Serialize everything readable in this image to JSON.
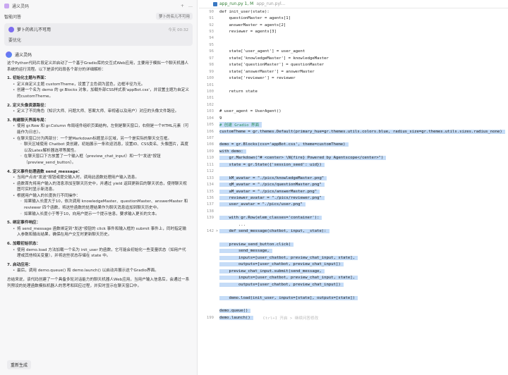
{
  "left": {
    "top_title": "通义灵码",
    "top_tool1": "+",
    "top_tool2": "…",
    "section_label": "智能问答",
    "section_tag": "萝卜的名儿不可用",
    "user_name": "萝卜的名儿不可用",
    "user_time": "今天 00:32",
    "user_msg": "要优化",
    "assistant_name": "通义灵码",
    "intro": "这个Python代码片段定义并启动了一个基于Gradio库的交互式Web应用，主要用于模拟一个聊天机器人系统的运行流程。以下是该代码段各个部分的详细解析：",
    "sections": [
      {
        "title": "1. 初始化主题与界面：",
        "items": [
          {
            "text": "定义自定义主题 customTheme，设置了主色调为蓝色，边框半径为无。"
          },
          {
            "text": "创建一个名为 demo 的 gr.Blocks 对象，加载外部CSS样式表'appBot.css'，并设置主题为自定义的customTheme。"
          }
        ]
      },
      {
        "title": "2. 定义头像资源路径：",
        "items": [
          {
            "text": "定义了不同角色（知识大师、问题大师、答案大师、审视者以及用户）对应的头像文件路径。"
          }
        ]
      },
      {
        "title": "3. 构建聊天界面布局：",
        "items": [
          {
            "text": "使用 gr.Row 和 gr.Column 布局组件组织页面结构，左侧是聊天窗口，右侧是一个HTML元素（可能作为日志）。"
          },
          {
            "text": "在聊天窗口分为两部分：一个是Markdown标题显示区域，另一个是实际的聊天交互框。"
          },
          {
            "text": "聊天区域使用 Chatbot 类创建，初始展示一条欢迎消息，设置ID、CSS类名、头像图片，高度以及Latex解析器选项等属性。",
            "child": true
          },
          {
            "text": "在聊天窗口下方放置了一个输入框（preview_chat_input）和一个\"发送\"按钮（preview_send_button）。",
            "child": true
          }
        ]
      },
      {
        "title": "4. 定义事件处理函数 send_message：",
        "items": [
          {
            "text": "当用户点击\"发送\"按钮或提交输入时，调用此函数处理用户输入消息。"
          },
          {
            "text": "函数首先将用户输入的消息添加至聊天历史中，并通过 yield 返回更新后的聊天状态，使得聊天视图可实时显示新消息。"
          },
          {
            "text": "根据用户输入的长度执行不同操作："
          },
          {
            "text": "如果输入长度大于10，依次调用 knowledgeMaster、questionMaster、answerMaster 和 reviewer 四个函数，将这些函数的处理结果作为聊天消息追加到聊天历史中。",
            "child": true
          },
          {
            "text": "如果输入长度小于等于10，向用户提示一个提示信息，要求输入更长的文本。",
            "child": true
          }
        ]
      },
      {
        "title": "5. 绑定事件响应：",
        "items": [
          {
            "text": "将 send_message 函数绑定到\"发送\"按钮的 click 事件和输入框的 submit 事件上，同时指定输入参数和输出结果，确保在用户交互时更新聊天历史。"
          }
        ]
      },
      {
        "title": "6. 加载初始状态：",
        "items": [
          {
            "text": "使用 demo.load 方法加载一个名为 init_user 的函数，它可能会初始化一些变量状态（如用户代理或其他相关变量），并将这些状态存储在 state 中。"
          }
        ]
      },
      {
        "title": "7. 启动应用：",
        "items": [
          {
            "text": "最后，调用 demo.queue() 和 demo.launch() 以启动并展示这个Gradio界面。"
          }
        ]
      }
    ],
    "summary": "总结来说，该代码创建了一个具备多轮对话能力的聊天机器人Web应用，当用户输入信息后，会通过一系列预设的处理函数模拟机器人的思考和回应过程，并实时显示在聊天窗口中。",
    "regen_label": "重新生成"
  },
  "editor": {
    "tab_label": "app_run.py 1, M",
    "tab_sub": "app_run.pyl...",
    "ghost_text": "Ctrl+I 开启 > 继续问答修改",
    "lines": [
      {
        "n": "90",
        "t": "def init_user(state):"
      },
      {
        "n": "91",
        "t": "    questionMaster = agents[1]"
      },
      {
        "n": "92",
        "t": "    answerMaster = agents[2]"
      },
      {
        "n": "93",
        "t": "    reviewer = agents[3]"
      },
      {
        "n": "94",
        "t": ""
      },
      {
        "n": "95",
        "t": ""
      },
      {
        "n": "96",
        "t": "    state['user_agent'] = user_agent"
      },
      {
        "n": "97",
        "t": "    state['knowledgeMaster'] = knowledgeMaster"
      },
      {
        "n": "98",
        "t": "    state['questionMaster'] = questionMaster"
      },
      {
        "n": "99",
        "t": "    state['answerMaster'] = answerMaster"
      },
      {
        "n": "100",
        "t": "    state['reviewer'] = reviewer"
      },
      {
        "n": "101",
        "t": ""
      },
      {
        "n": "100",
        "t": "    return state"
      },
      {
        "n": "101",
        "t": ""
      },
      {
        "n": "102",
        "t": ""
      },
      {
        "n": "103",
        "t": "# user_agent = UserAgent()"
      },
      {
        "n": "104",
        "t": "9"
      },
      {
        "n": "105",
        "t": "# 创建 Gradio 界面",
        "sel": true,
        "cm": true
      },
      {
        "n": "106",
        "t": "customTheme = gr.themes.Default(primary_hue=gr.themes.utils.colors.blue, radius_size=gr.themes.utils.sizes.radius_none)",
        "sel": true
      },
      {
        "n": "107",
        "t": "",
        "sel": true
      },
      {
        "n": "108",
        "t": "demo = gr.Blocks(css='appBot.css', theme=customTheme)",
        "sel": true
      },
      {
        "n": "109",
        "t": "with demo:",
        "sel": true
      },
      {
        "n": "110",
        "t": "    gr.Markdown(\"# <center> \\N{fire} Powered by Agentscope</center>\")",
        "sel": true
      },
      {
        "n": "111",
        "t": "    state = gr.State({'session_seed': uid})",
        "sel": true
      },
      {
        "n": "112",
        "t": "",
        "sel": true
      },
      {
        "n": "133",
        "t": "    kM_avatar = \"./pics/knowledgeMaster.png\"",
        "sel": true
      },
      {
        "n": "134",
        "t": "    qM_avatar = \"./pics/questionMaster.png\"",
        "sel": true
      },
      {
        "n": "135",
        "t": "    aM_avatar = \"./pics/answerMaster.png\"",
        "sel": true
      },
      {
        "n": "136",
        "t": "    reviewer_avatar = \"./pics/reviewer.png\"",
        "sel": true
      },
      {
        "n": "137",
        "t": "    user_avatar = \"./pics/user.png\"",
        "sel": true
      },
      {
        "n": "138",
        "t": "",
        "sel": true
      },
      {
        "n": "139",
        "t": "    with gr.Row(elem_classes='container'):",
        "sel": true
      },
      {
        "n": "",
        "t": "        ..."
      },
      {
        "n": "142",
        "t": "    def send_message(chatbot, input, _state):",
        "sel": true,
        "g": ">"
      },
      {
        "n": "",
        "t": ""
      },
      {
        "n": "",
        "t": "    preview_send_button.click(",
        "sel": true
      },
      {
        "n": "",
        "t": "        send_message,",
        "sel": true
      },
      {
        "n": "",
        "t": "        inputs=[user_chatbot, preview_chat_input, state],",
        "sel": true
      },
      {
        "n": "",
        "t": "        outputs=[user_chatbot, preview_chat_input])",
        "sel": true
      },
      {
        "n": "",
        "t": "    preview_chat_input.submit(send_message,",
        "sel": true
      },
      {
        "n": "",
        "t": "        inputs=[user_chatbot, preview_chat_input, state],",
        "sel": true
      },
      {
        "n": "",
        "t": "        outputs=[user_chatbot, preview_chat_input])",
        "sel": true
      },
      {
        "n": "",
        "t": "",
        "sel": true
      },
      {
        "n": "",
        "t": "    demo.load(init_user, inputs=[state], outputs=[state])",
        "sel": true
      },
      {
        "n": "",
        "t": "",
        "sel": true
      },
      {
        "n": "",
        "t": "demo.queue()",
        "sel": true
      },
      {
        "n": "199",
        "t": "demo.launch()",
        "sel": true,
        "ghost": true
      }
    ]
  }
}
